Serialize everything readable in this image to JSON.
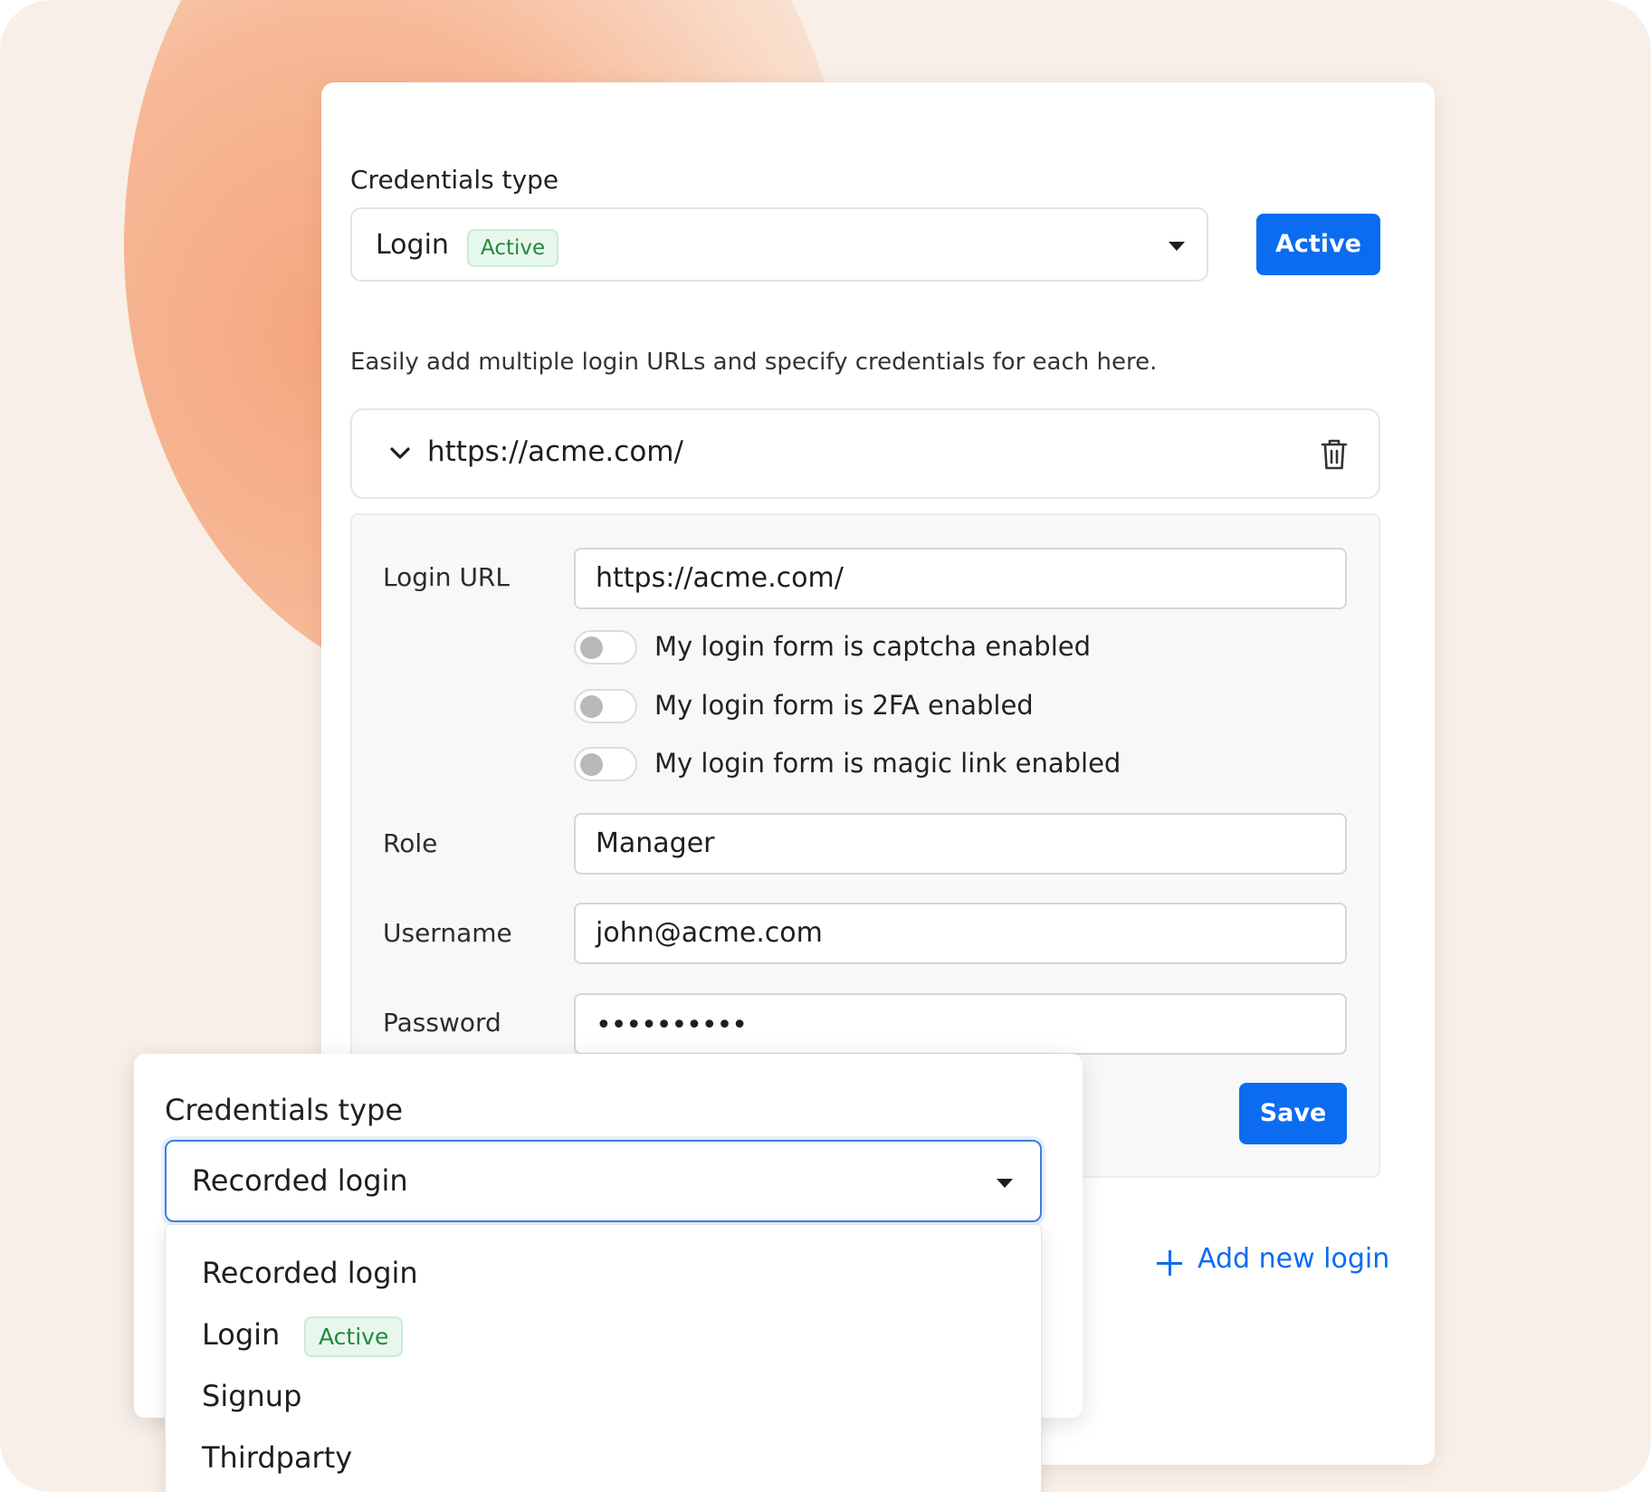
{
  "credentials": {
    "title": "Credentials type",
    "selected": "Login",
    "selected_badge": "Active",
    "status_button": "Active"
  },
  "description": "Easily add multiple login URLs and specify credentials for each here.",
  "login_entry": {
    "url_header": "https://acme.com/",
    "fields": {
      "login_url_label": "Login URL",
      "login_url_value": "https://acme.com/",
      "toggles": [
        {
          "label": "My login form is captcha enabled",
          "on": false
        },
        {
          "label": "My login form is 2FA enabled",
          "on": false
        },
        {
          "label": "My login form is magic link enabled",
          "on": false
        }
      ],
      "role_label": "Role",
      "role_value": "Manager",
      "username_label": "Username",
      "username_value": "john@acme.com",
      "password_label": "Password",
      "password_value": "••••••••••"
    },
    "save_label": "Save"
  },
  "add_new_login": "Add new login",
  "dropdown": {
    "title": "Credentials type",
    "selected": "Recorded login",
    "options": [
      {
        "label": "Recorded login",
        "badge": ""
      },
      {
        "label": "Login",
        "badge": "Active"
      },
      {
        "label": "Signup",
        "badge": ""
      },
      {
        "label": "Thirdparty",
        "badge": ""
      }
    ]
  },
  "colors": {
    "accent": "#0b6cf0",
    "badge_green": "#1f8a3b",
    "blob": "#f5a67e",
    "background": "#f8efe8"
  },
  "icons": {
    "chevron": "chevron-down-icon",
    "caret": "caret-down-icon",
    "delete": "trash-icon",
    "add": "plus-icon"
  }
}
